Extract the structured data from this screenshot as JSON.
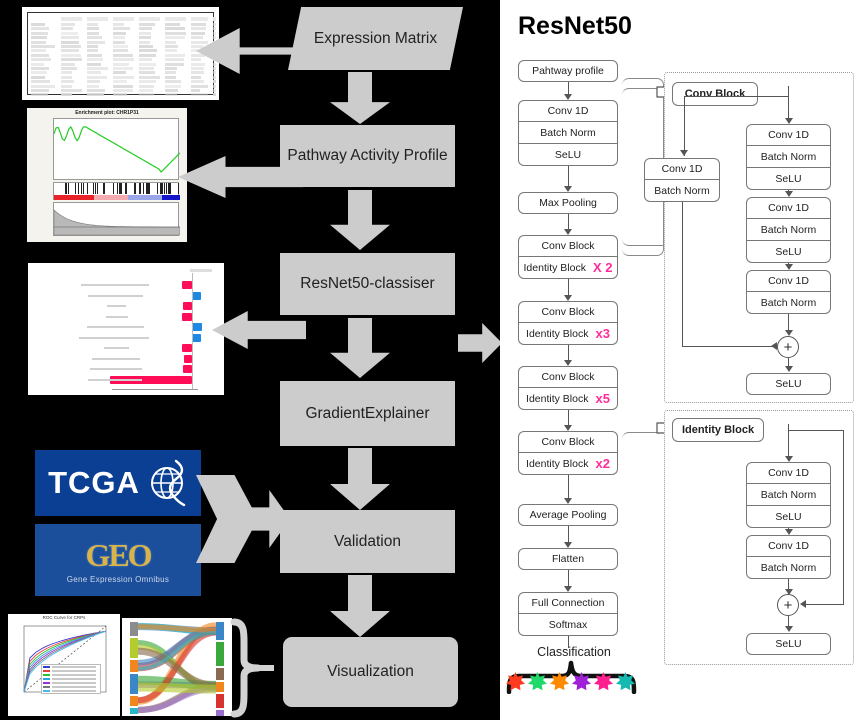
{
  "pipeline": {
    "expression_matrix": "Expression Matrix",
    "pathway_activity": "Pathway Activity Profile",
    "classifier": "ResNet50-classiser",
    "explainer": "GradientExplainer",
    "validation": "Validation",
    "visualization": "Visualization"
  },
  "resnet": {
    "title": "ResNet50",
    "main_chain": [
      {
        "label": "Pahtway profile"
      },
      {
        "label": "Conv 1D"
      },
      {
        "label": "Batch Norm"
      },
      {
        "label": "SeLU"
      },
      {
        "label": "Max Pooling"
      },
      {
        "label": "Conv Block"
      },
      {
        "label": "Identity Block",
        "mult": "X 2"
      },
      {
        "label": "Conv Block"
      },
      {
        "label": "Identity Block",
        "mult": "x3"
      },
      {
        "label": "Conv Block"
      },
      {
        "label": "Identity Block",
        "mult": "x5"
      },
      {
        "label": "Conv Block"
      },
      {
        "label": "Identity Block",
        "mult": "x2"
      },
      {
        "label": "Average Pooling"
      },
      {
        "label": "Flatten"
      },
      {
        "label": "Full Connection"
      },
      {
        "label": "Softmax"
      }
    ],
    "classification_label": "Classification",
    "class_colors": [
      "#ff3b1f",
      "#1fd96b",
      "#ff8a00",
      "#a020d8",
      "#ff1f8f",
      "#16b9b0"
    ],
    "conv_block": {
      "title": "Conv Block",
      "shortcut": [
        "Conv 1D",
        "Batch Norm"
      ],
      "main": [
        "Conv 1D",
        "Batch Norm",
        "SeLU",
        "Conv 1D",
        "Batch Norm",
        "SeLU",
        "Conv 1D",
        "Batch Norm"
      ],
      "add_symbol": "+",
      "output": "SeLU"
    },
    "identity_block": {
      "title": "Identity Block",
      "main": [
        "Conv 1D",
        "Batch Norm",
        "SeLU",
        "Conv 1D",
        "Batch Norm"
      ],
      "add_symbol": "+",
      "output": "SeLU"
    }
  },
  "figures": {
    "expression_table": {
      "name": "expression-matrix-table"
    },
    "gsea": {
      "title": "Enrichment plot: CHR1P31"
    },
    "shap": {
      "name": "shap-summary-plot"
    },
    "tcga_logo": {
      "text": "TCGA"
    },
    "geo_logo": {
      "text": "GEO",
      "subtitle": "Gene Expression Omnibus"
    },
    "pr_curve": {
      "title": "ROC Curve for CRPs"
    },
    "sankey": {
      "name": "sankey-diagram"
    }
  },
  "colors": {
    "box_fill": "#cccccc",
    "accent_pink": "#ff2d9b",
    "tcga_blue": "#0b3f94",
    "geo_blue": "#1b4f9c",
    "geo_gold": "#d9b44a"
  }
}
